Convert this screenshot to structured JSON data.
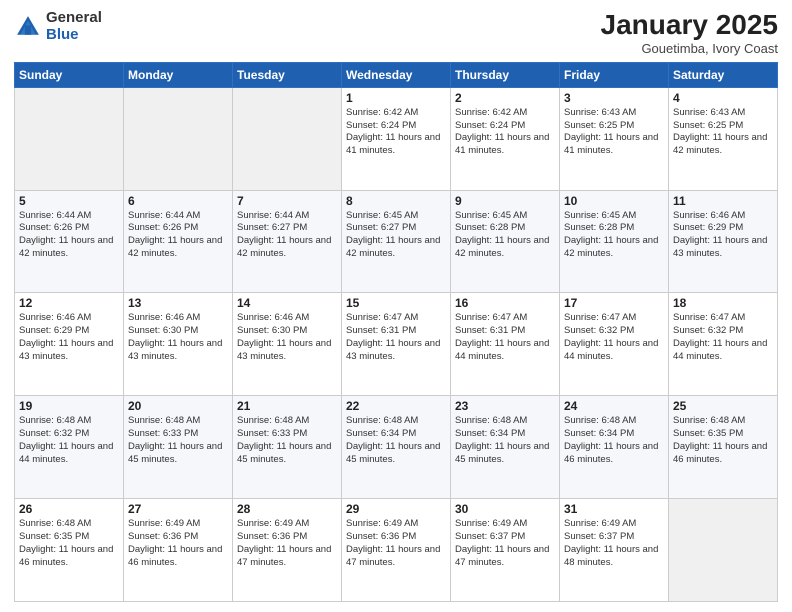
{
  "logo": {
    "general": "General",
    "blue": "Blue"
  },
  "header": {
    "month": "January 2025",
    "location": "Gouetimba, Ivory Coast"
  },
  "days_of_week": [
    "Sunday",
    "Monday",
    "Tuesday",
    "Wednesday",
    "Thursday",
    "Friday",
    "Saturday"
  ],
  "weeks": [
    [
      {
        "day": "",
        "info": ""
      },
      {
        "day": "",
        "info": ""
      },
      {
        "day": "",
        "info": ""
      },
      {
        "day": "1",
        "info": "Sunrise: 6:42 AM\nSunset: 6:24 PM\nDaylight: 11 hours and 41 minutes."
      },
      {
        "day": "2",
        "info": "Sunrise: 6:42 AM\nSunset: 6:24 PM\nDaylight: 11 hours and 41 minutes."
      },
      {
        "day": "3",
        "info": "Sunrise: 6:43 AM\nSunset: 6:25 PM\nDaylight: 11 hours and 41 minutes."
      },
      {
        "day": "4",
        "info": "Sunrise: 6:43 AM\nSunset: 6:25 PM\nDaylight: 11 hours and 42 minutes."
      }
    ],
    [
      {
        "day": "5",
        "info": "Sunrise: 6:44 AM\nSunset: 6:26 PM\nDaylight: 11 hours and 42 minutes."
      },
      {
        "day": "6",
        "info": "Sunrise: 6:44 AM\nSunset: 6:26 PM\nDaylight: 11 hours and 42 minutes."
      },
      {
        "day": "7",
        "info": "Sunrise: 6:44 AM\nSunset: 6:27 PM\nDaylight: 11 hours and 42 minutes."
      },
      {
        "day": "8",
        "info": "Sunrise: 6:45 AM\nSunset: 6:27 PM\nDaylight: 11 hours and 42 minutes."
      },
      {
        "day": "9",
        "info": "Sunrise: 6:45 AM\nSunset: 6:28 PM\nDaylight: 11 hours and 42 minutes."
      },
      {
        "day": "10",
        "info": "Sunrise: 6:45 AM\nSunset: 6:28 PM\nDaylight: 11 hours and 42 minutes."
      },
      {
        "day": "11",
        "info": "Sunrise: 6:46 AM\nSunset: 6:29 PM\nDaylight: 11 hours and 43 minutes."
      }
    ],
    [
      {
        "day": "12",
        "info": "Sunrise: 6:46 AM\nSunset: 6:29 PM\nDaylight: 11 hours and 43 minutes."
      },
      {
        "day": "13",
        "info": "Sunrise: 6:46 AM\nSunset: 6:30 PM\nDaylight: 11 hours and 43 minutes."
      },
      {
        "day": "14",
        "info": "Sunrise: 6:46 AM\nSunset: 6:30 PM\nDaylight: 11 hours and 43 minutes."
      },
      {
        "day": "15",
        "info": "Sunrise: 6:47 AM\nSunset: 6:31 PM\nDaylight: 11 hours and 43 minutes."
      },
      {
        "day": "16",
        "info": "Sunrise: 6:47 AM\nSunset: 6:31 PM\nDaylight: 11 hours and 44 minutes."
      },
      {
        "day": "17",
        "info": "Sunrise: 6:47 AM\nSunset: 6:32 PM\nDaylight: 11 hours and 44 minutes."
      },
      {
        "day": "18",
        "info": "Sunrise: 6:47 AM\nSunset: 6:32 PM\nDaylight: 11 hours and 44 minutes."
      }
    ],
    [
      {
        "day": "19",
        "info": "Sunrise: 6:48 AM\nSunset: 6:32 PM\nDaylight: 11 hours and 44 minutes."
      },
      {
        "day": "20",
        "info": "Sunrise: 6:48 AM\nSunset: 6:33 PM\nDaylight: 11 hours and 45 minutes."
      },
      {
        "day": "21",
        "info": "Sunrise: 6:48 AM\nSunset: 6:33 PM\nDaylight: 11 hours and 45 minutes."
      },
      {
        "day": "22",
        "info": "Sunrise: 6:48 AM\nSunset: 6:34 PM\nDaylight: 11 hours and 45 minutes."
      },
      {
        "day": "23",
        "info": "Sunrise: 6:48 AM\nSunset: 6:34 PM\nDaylight: 11 hours and 45 minutes."
      },
      {
        "day": "24",
        "info": "Sunrise: 6:48 AM\nSunset: 6:34 PM\nDaylight: 11 hours and 46 minutes."
      },
      {
        "day": "25",
        "info": "Sunrise: 6:48 AM\nSunset: 6:35 PM\nDaylight: 11 hours and 46 minutes."
      }
    ],
    [
      {
        "day": "26",
        "info": "Sunrise: 6:48 AM\nSunset: 6:35 PM\nDaylight: 11 hours and 46 minutes."
      },
      {
        "day": "27",
        "info": "Sunrise: 6:49 AM\nSunset: 6:36 PM\nDaylight: 11 hours and 46 minutes."
      },
      {
        "day": "28",
        "info": "Sunrise: 6:49 AM\nSunset: 6:36 PM\nDaylight: 11 hours and 47 minutes."
      },
      {
        "day": "29",
        "info": "Sunrise: 6:49 AM\nSunset: 6:36 PM\nDaylight: 11 hours and 47 minutes."
      },
      {
        "day": "30",
        "info": "Sunrise: 6:49 AM\nSunset: 6:37 PM\nDaylight: 11 hours and 47 minutes."
      },
      {
        "day": "31",
        "info": "Sunrise: 6:49 AM\nSunset: 6:37 PM\nDaylight: 11 hours and 48 minutes."
      },
      {
        "day": "",
        "info": ""
      }
    ]
  ]
}
